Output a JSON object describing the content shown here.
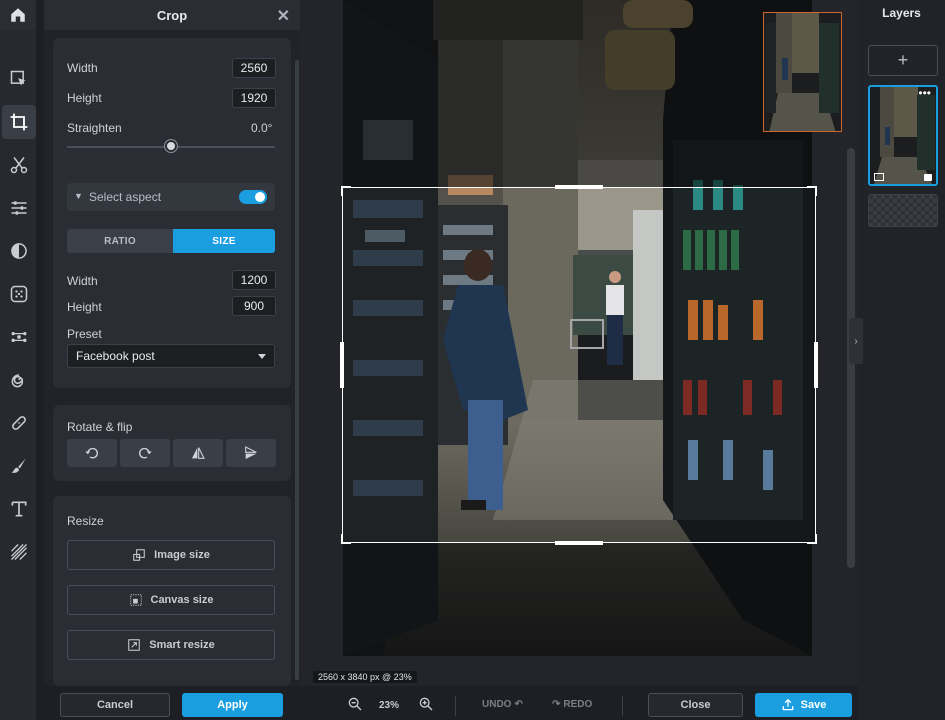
{
  "panel": {
    "title": "Crop",
    "width_label": "Width",
    "width_value": "2560",
    "height_label": "Height",
    "height_value": "1920",
    "straighten_label": "Straighten",
    "straighten_value": "0.0°",
    "straighten_level": 0.5,
    "aspect_label": "Select aspect",
    "aspect_enabled": true,
    "tab_ratio": "RATIO",
    "tab_size": "SIZE",
    "size_width_label": "Width",
    "size_width_value": "1200",
    "size_height_label": "Height",
    "size_height_value": "900",
    "preset_label": "Preset",
    "preset_value": "Facebook post",
    "rotate_label": "Rotate & flip",
    "resize_label": "Resize",
    "image_size": "Image size",
    "canvas_size": "Canvas size",
    "smart_resize": "Smart resize"
  },
  "canvas": {
    "info": "2560 x 3840 px @ 23%"
  },
  "layers": {
    "title": "Layers",
    "add": "+"
  },
  "bottom": {
    "cancel": "Cancel",
    "apply": "Apply",
    "zoom": "23%",
    "undo": "UNDO",
    "redo": "REDO",
    "close": "Close",
    "save": "Save"
  },
  "colors": {
    "accent": "#1a9ee0",
    "navigator_border": "#c9672e"
  }
}
